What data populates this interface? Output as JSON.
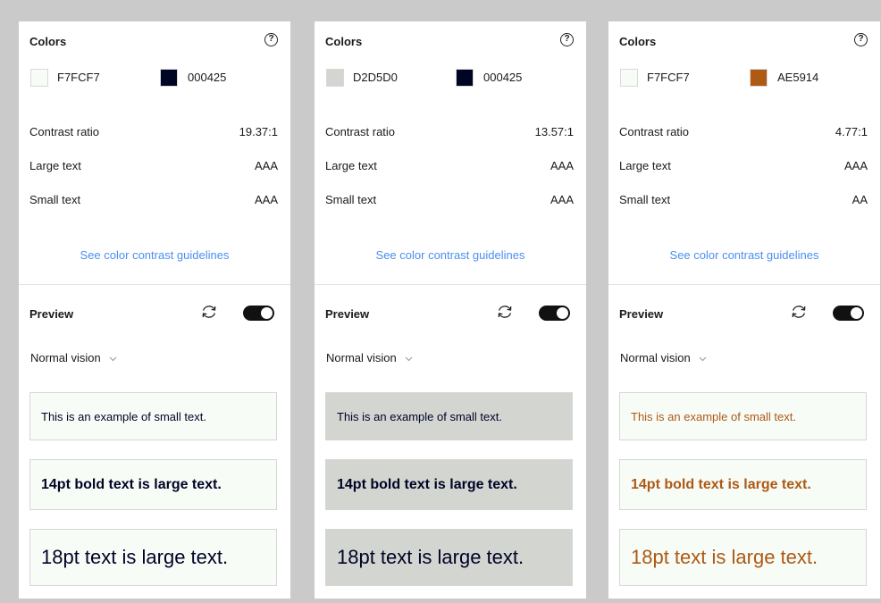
{
  "panels": [
    {
      "colors_title": "Colors",
      "help_glyph": "?",
      "background": {
        "hex": "F7FCF7",
        "color": "#F7FCF7"
      },
      "foreground": {
        "hex": "000425",
        "color": "#000425"
      },
      "contrast": {
        "label": "Contrast ratio",
        "value": "19.37:1"
      },
      "large_text": {
        "label": "Large text",
        "value": "AAA"
      },
      "small_text": {
        "label": "Small text",
        "value": "AAA"
      },
      "guidelines_link": "See color contrast guidelines",
      "preview_title": "Preview",
      "vision": "Normal vision",
      "samples": {
        "small": "This is an example of small text.",
        "bold": "14pt bold text is large text.",
        "large": "18pt text is large text."
      },
      "toggle_on": true
    },
    {
      "colors_title": "Colors",
      "help_glyph": "?",
      "background": {
        "hex": "D2D5D0",
        "color": "#D2D5D0"
      },
      "foreground": {
        "hex": "000425",
        "color": "#000425"
      },
      "contrast": {
        "label": "Contrast ratio",
        "value": "13.57:1"
      },
      "large_text": {
        "label": "Large text",
        "value": "AAA"
      },
      "small_text": {
        "label": "Small text",
        "value": "AAA"
      },
      "guidelines_link": "See color contrast guidelines",
      "preview_title": "Preview",
      "vision": "Normal vision",
      "samples": {
        "small": "This is an example of small text.",
        "bold": "14pt bold text is large text.",
        "large": "18pt text is large text."
      },
      "toggle_on": true
    },
    {
      "colors_title": "Colors",
      "help_glyph": "?",
      "background": {
        "hex": "F7FCF7",
        "color": "#F7FCF7"
      },
      "foreground": {
        "hex": "AE5914",
        "color": "#AE5914"
      },
      "contrast": {
        "label": "Contrast ratio",
        "value": "4.77:1"
      },
      "large_text": {
        "label": "Large text",
        "value": "AAA"
      },
      "small_text": {
        "label": "Small text",
        "value": "AA"
      },
      "guidelines_link": "See color contrast guidelines",
      "preview_title": "Preview",
      "vision": "Normal vision",
      "samples": {
        "small": "This is an example of small text.",
        "bold": "14pt bold text is large text.",
        "large": "18pt text is large text."
      },
      "toggle_on": true
    }
  ],
  "theme": {
    "page_background": "#CACACA",
    "link_color": "#4B8FF0",
    "icons": {
      "help": "question-circle-icon",
      "refresh": "refresh-icon",
      "chevron": "chevron-down-icon"
    }
  }
}
